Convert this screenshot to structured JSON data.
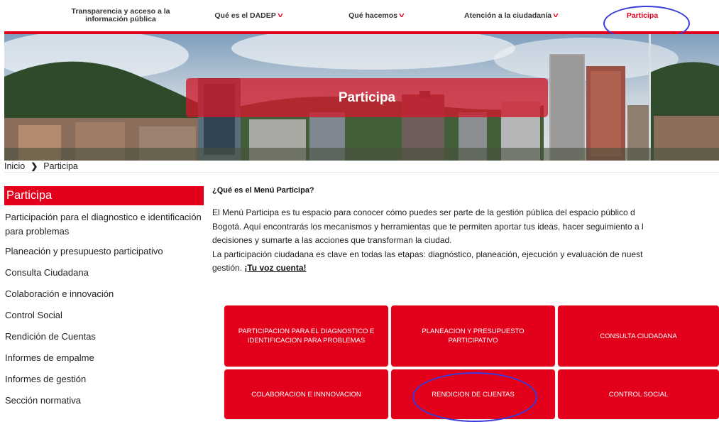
{
  "nav": {
    "transparency": "Transparencia y acceso a la información pública",
    "que_es": "Qué es el DADEP",
    "que_hacemos": "Qué hacemos",
    "atencion": "Atención a la ciudadanía",
    "participa": "Participa",
    "chevron": "˅"
  },
  "hero": {
    "title": "Participa"
  },
  "breadcrumb": {
    "home": "Inicio",
    "separator": "❯",
    "current": "Participa"
  },
  "sidebar": {
    "title": "Participa",
    "items": [
      "Participación para el diagnostico e identificación para problemas",
      "Planeación y presupuesto participativo",
      "Consulta Ciudadana",
      "Colaboración e innovación",
      "Control Social",
      "Rendición de Cuentas",
      "Informes de empalme",
      "Informes de gestión",
      "Sección normativa"
    ]
  },
  "main": {
    "heading": "¿Qué es el Menú Participa?",
    "lines": [
      "El Menú Participa es tu espacio para conocer cómo puedes ser parte de la gestión pública del espacio público d",
      "Bogotá. Aquí encontrarás los mecanismos y herramientas que te permiten aportar tus ideas, hacer seguimiento a l",
      "decisiones y sumarte a las acciones que transforman la ciudad.",
      "La participación ciudadana es clave en todas las etapas: diagnóstico, planeación, ejecución y evaluación de nuest",
      "gestión. "
    ],
    "link": "¡Tu voz cuenta!"
  },
  "tiles": [
    "PARTICIPACION PARA EL DIAGNOSTICO E IDENTIFICACION PARA PROBLEMAS",
    "PLANEACION Y PRESUPUESTO PARTICIPATIVO",
    "CONSULTA CIUDADANA",
    "COLABORACION E INNNOVACION",
    "RENDICION DE CUENTAS",
    "CONTROL SOCIAL"
  ],
  "colors": {
    "brand_red": "#e3001b",
    "annotation_blue": "#3a3bd8"
  }
}
